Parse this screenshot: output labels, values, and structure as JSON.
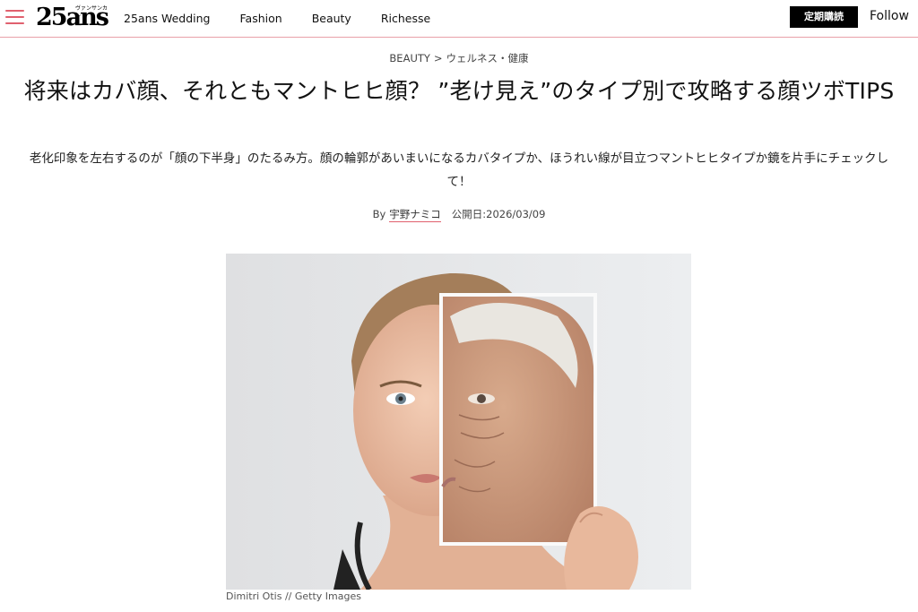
{
  "header": {
    "logo_text": "25ans",
    "logo_ruby": "ヴァンサンカン",
    "nav": [
      "25ans Wedding",
      "Fashion",
      "Beauty",
      "Richesse"
    ],
    "subscribe_label": "定期購読",
    "follow_label": "Follow",
    "menu_icon": "hamburger-menu-icon",
    "accent_color": "#e0606e"
  },
  "breadcrumb": {
    "section": "BEAUTY",
    "separator": ">",
    "category": "ウェルネス・健康"
  },
  "article": {
    "title": "将来はカバ顔、それともマントヒヒ顔？ ”老け見え”のタイプ別で攻略する顔ツボTIPS",
    "dek": "老化印象を左右するのが「顔の下半身」のたるみ方。顔の輪郭があいまいになるカバタイプか、ほうれい線が目立つマントヒヒタイプか鏡を片手にチェックして！",
    "by_label": "By",
    "author": "宇野ナミコ",
    "published": "公開日:2026/03/09"
  },
  "hero": {
    "credit": "Dimitri Otis  // Getty Images"
  }
}
